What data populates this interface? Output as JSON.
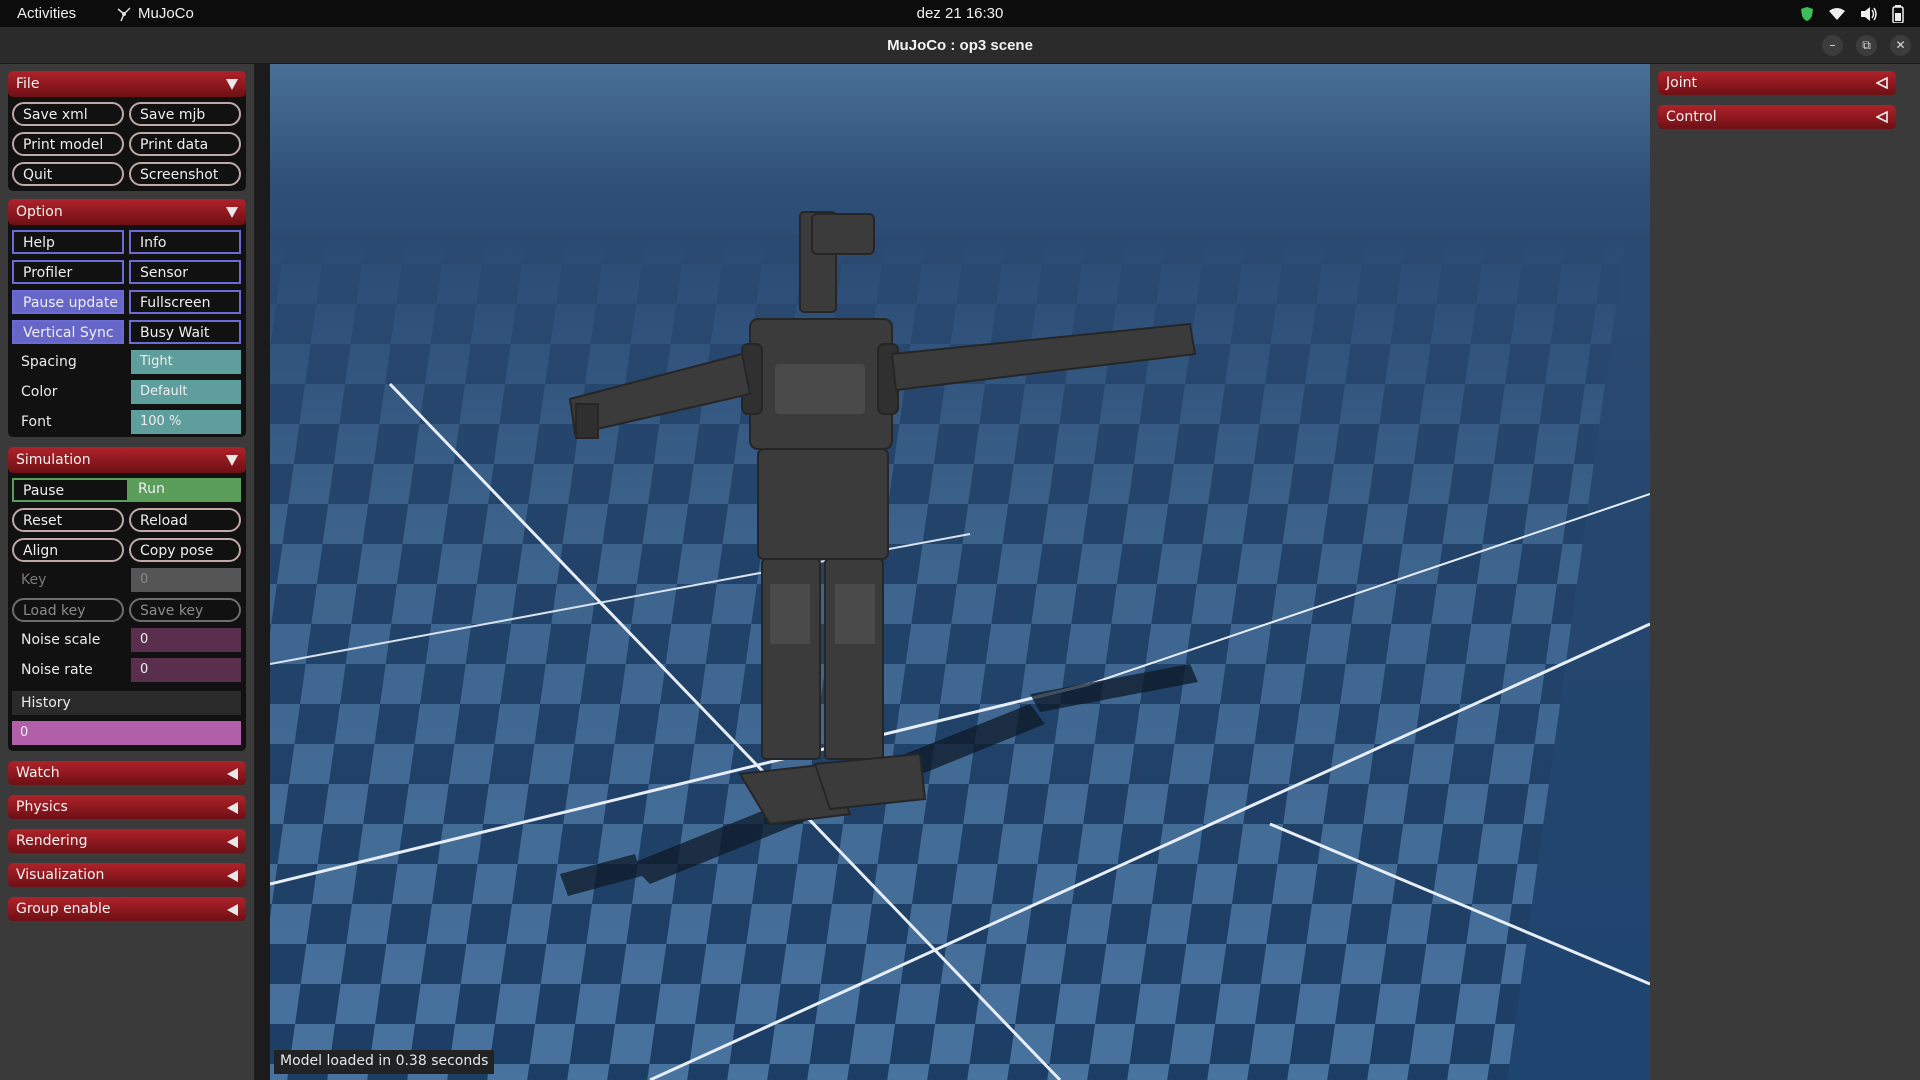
{
  "topbar": {
    "activities": "Activities",
    "app_name": "MuJoCo",
    "clock": "dez 21  16:30"
  },
  "window": {
    "title": "MuJoCo : op3 scene"
  },
  "left": {
    "file": {
      "header": "File",
      "buttons": [
        "Save xml",
        "Save mjb",
        "Print model",
        "Print data",
        "Quit",
        "Screenshot"
      ]
    },
    "option": {
      "header": "Option",
      "buttons": [
        "Help",
        "Info",
        "Profiler",
        "Sensor",
        "Pause update",
        "Fullscreen",
        "Vertical Sync",
        "Busy Wait"
      ],
      "spacing_label": "Spacing",
      "spacing_value": "Tight",
      "color_label": "Color",
      "color_value": "Default",
      "font_label": "Font",
      "font_value": "100 %"
    },
    "simulation": {
      "header": "Simulation",
      "pause": "Pause",
      "run": "Run",
      "buttons": [
        "Reset",
        "Reload",
        "Align",
        "Copy pose"
      ],
      "key_label": "Key",
      "key_value": "0",
      "load_key": "Load key",
      "save_key": "Save key",
      "noise_scale_label": "Noise scale",
      "noise_scale_value": "0",
      "noise_rate_label": "Noise rate",
      "noise_rate_value": "0",
      "history_label": "History",
      "history_value": "0"
    },
    "collapsed": [
      "Watch",
      "Physics",
      "Rendering",
      "Visualization",
      "Group enable"
    ]
  },
  "right": {
    "sections": [
      "Joint",
      "Control"
    ]
  },
  "status": "Model loaded in 0.38 seconds",
  "colors": {
    "section_header": "#9a1c23",
    "toggle_on": "#6666c8",
    "select": "#5e9e9c",
    "run": "#5b9d5b",
    "slider": "#b05fa8"
  }
}
